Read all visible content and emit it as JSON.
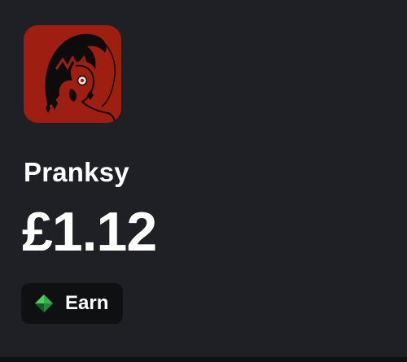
{
  "creator": {
    "name": "Pranksy",
    "avatar_icon": "jester-avatar-icon"
  },
  "balance": {
    "amount": "£1.12"
  },
  "earn_button": {
    "label": "Earn",
    "icon": "diamond-icon",
    "icon_color": "#34b34a"
  },
  "colors": {
    "background": "#1f2026",
    "avatar_background": "#9e1f12",
    "button_background": "#0f1012",
    "text": "#ffffff"
  }
}
